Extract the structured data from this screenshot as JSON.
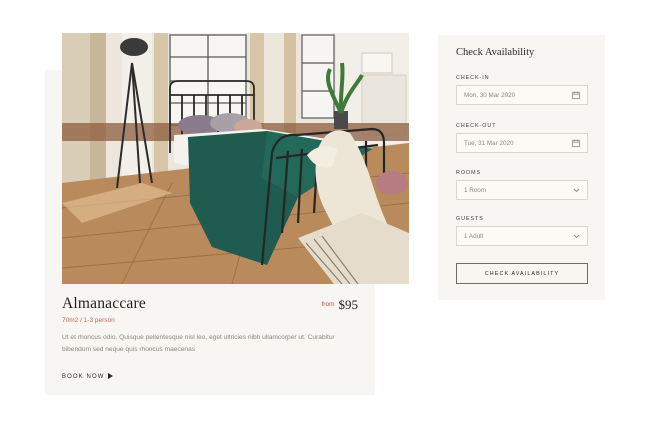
{
  "room": {
    "name": "Almanaccare",
    "price_prefix": "from",
    "price": "$95",
    "meta": "70m2 / 1-3 person",
    "description": "Ut et rhoncus odio. Quisque pellentesque nisl leo, eget ultricies nibh ullamcorper ut. Curabitur bibendum sed neque quis rhoncus maecenas",
    "cta": "BOOK NOW"
  },
  "availability": {
    "title": "Check Availability",
    "check_in_label": "CHECK-IN",
    "check_in_value": "Mon, 30 Mar 2020",
    "check_out_label": "CHECK-OUT",
    "check_out_value": "Tue, 31 Mar 2020",
    "rooms_label": "ROOMS",
    "rooms_value": "1 Room",
    "guests_label": "GUESTS",
    "guests_value": "1 Adult",
    "button": "CHECK AVAILABILITY"
  },
  "icons": {
    "calendar": "calendar-icon",
    "dropdown": "chevron-down-icon",
    "arrow": "arrow-right-icon"
  },
  "colors": {
    "accent": "#c0685a",
    "panel_bg": "#f8f6f2",
    "blanket": "#1f5b4e"
  }
}
